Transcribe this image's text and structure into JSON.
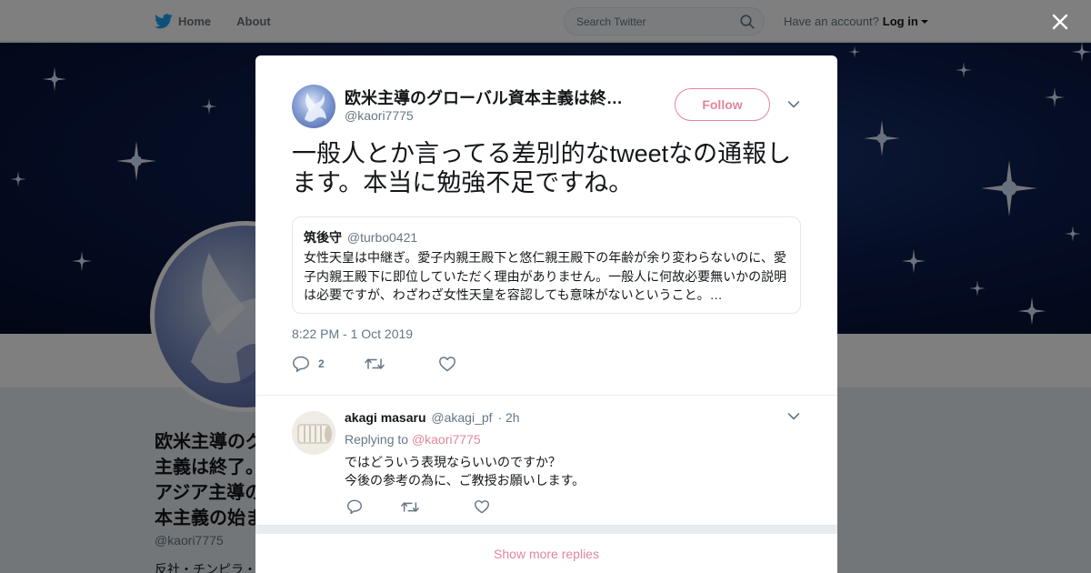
{
  "nav": {
    "home_label": "Home",
    "about_label": "About",
    "search_placeholder": "Search Twitter",
    "account_text": "Have an account?",
    "login_label": "Log in"
  },
  "profile": {
    "name": "欧米主導のグ",
    "name_lines": [
      "欧米主導のグ",
      "主義は終了。",
      "アジア主導の",
      "本主義の始ま"
    ],
    "handle": "@kaori7775",
    "bio": "反社・チンピラ・"
  },
  "tweet": {
    "author_name": "欧米主導のグローバル資本主義は終…",
    "author_handle": "@kaori7775",
    "follow_label": "Follow",
    "text": "一般人とか言ってる差別的なtweetなの通報します。本当に勉強不足ですね。",
    "quote": {
      "name": "筑後守",
      "handle": "@turbo0421",
      "text": "女性天皇は中継ぎ。愛子内親王殿下と悠仁親王殿下の年齢が余り変わらないのに、愛子内親王殿下に即位していただく理由がありません。一般人に何故必要無いかの説明は必要ですが、わざわざ女性天皇を容認しても意味がないということ。…"
    },
    "timestamp": "8:22 PM - 1 Oct 2019",
    "reply_count": "2"
  },
  "reply": {
    "name": "akagi masaru",
    "handle": "@akagi_pf",
    "time": "· 2h",
    "replying_prefix": "Replying to",
    "replying_to": "@kaori7775",
    "text_line1": "ではどういう表現ならいいのですか？",
    "text_line2": "今後の参考の為に、ご教授お願いします。"
  },
  "show_more_label": "Show more replies",
  "colors": {
    "accent": "#e2869c",
    "twitter_blue": "#1da1f2",
    "muted": "#657786"
  }
}
